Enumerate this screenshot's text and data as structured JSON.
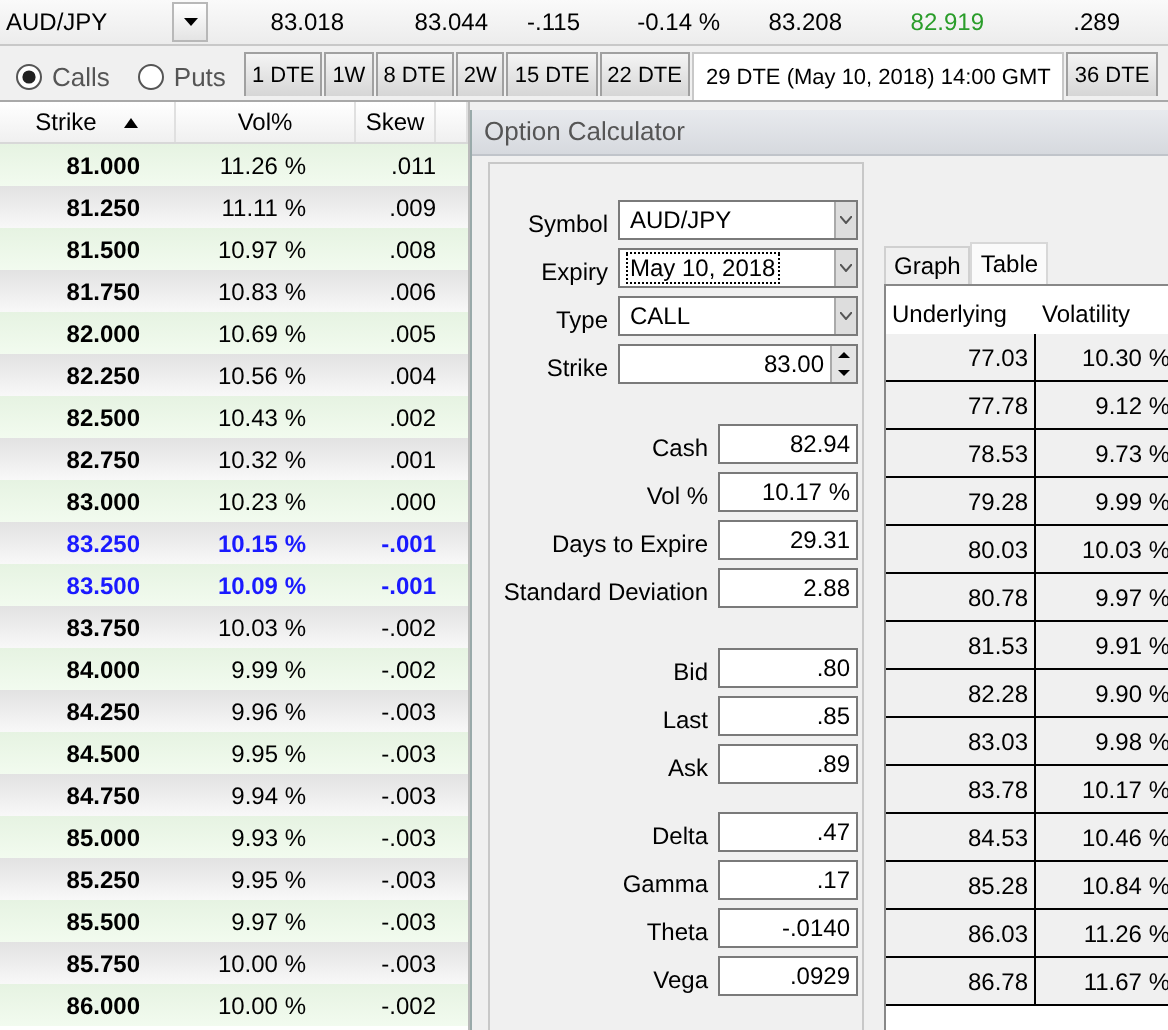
{
  "ticker": {
    "symbol": "AUD/JPY",
    "quotes": [
      {
        "text": "83.018",
        "kind": "plain"
      },
      {
        "text": "83.044",
        "kind": "plain"
      },
      {
        "text": "-.115",
        "kind": "plain"
      },
      {
        "text": "-0.14 %",
        "kind": "plain"
      },
      {
        "text": "83.208",
        "kind": "plain"
      },
      {
        "text": "82.919",
        "kind": "up"
      },
      {
        "text": ".289",
        "kind": "plain"
      }
    ]
  },
  "option_types": [
    {
      "label": "Calls",
      "selected": true
    },
    {
      "label": "Puts",
      "selected": false
    }
  ],
  "expiry_tabs": [
    {
      "label": "1 DTE",
      "selected": false
    },
    {
      "label": "1W",
      "selected": false
    },
    {
      "label": "8 DTE",
      "selected": false
    },
    {
      "label": "2W",
      "selected": false
    },
    {
      "label": "15 DTE",
      "selected": false
    },
    {
      "label": "22 DTE",
      "selected": false
    },
    {
      "label": "29 DTE (May 10, 2018) 14:00 GMT",
      "selected": true
    },
    {
      "label": "36 DTE",
      "selected": false
    }
  ],
  "chain": {
    "columns": [
      {
        "label": "Strike",
        "sorted": true
      },
      {
        "label": "Vol%",
        "sorted": false
      },
      {
        "label": "Skew",
        "sorted": false
      }
    ],
    "rows": [
      {
        "strike": "81.000",
        "vol": "11.26 %",
        "skew": ".011",
        "highlighted": false
      },
      {
        "strike": "81.250",
        "vol": "11.11 %",
        "skew": ".009",
        "highlighted": false
      },
      {
        "strike": "81.500",
        "vol": "10.97 %",
        "skew": ".008",
        "highlighted": false
      },
      {
        "strike": "81.750",
        "vol": "10.83 %",
        "skew": ".006",
        "highlighted": false
      },
      {
        "strike": "82.000",
        "vol": "10.69 %",
        "skew": ".005",
        "highlighted": false
      },
      {
        "strike": "82.250",
        "vol": "10.56 %",
        "skew": ".004",
        "highlighted": false
      },
      {
        "strike": "82.500",
        "vol": "10.43 %",
        "skew": ".002",
        "highlighted": false
      },
      {
        "strike": "82.750",
        "vol": "10.32 %",
        "skew": ".001",
        "highlighted": false
      },
      {
        "strike": "83.000",
        "vol": "10.23 %",
        "skew": ".000",
        "highlighted": false
      },
      {
        "strike": "83.250",
        "vol": "10.15 %",
        "skew": "-.001",
        "highlighted": true
      },
      {
        "strike": "83.500",
        "vol": "10.09 %",
        "skew": "-.001",
        "highlighted": true
      },
      {
        "strike": "83.750",
        "vol": "10.03 %",
        "skew": "-.002",
        "highlighted": false
      },
      {
        "strike": "84.000",
        "vol": "9.99 %",
        "skew": "-.002",
        "highlighted": false
      },
      {
        "strike": "84.250",
        "vol": "9.96 %",
        "skew": "-.003",
        "highlighted": false
      },
      {
        "strike": "84.500",
        "vol": "9.95 %",
        "skew": "-.003",
        "highlighted": false
      },
      {
        "strike": "84.750",
        "vol": "9.94 %",
        "skew": "-.003",
        "highlighted": false
      },
      {
        "strike": "85.000",
        "vol": "9.93 %",
        "skew": "-.003",
        "highlighted": false
      },
      {
        "strike": "85.250",
        "vol": "9.95 %",
        "skew": "-.003",
        "highlighted": false
      },
      {
        "strike": "85.500",
        "vol": "9.97 %",
        "skew": "-.003",
        "highlighted": false
      },
      {
        "strike": "85.750",
        "vol": "10.00 %",
        "skew": "-.003",
        "highlighted": false
      },
      {
        "strike": "86.000",
        "vol": "10.00 %",
        "skew": "-.002",
        "highlighted": false
      }
    ]
  },
  "calculator": {
    "title": "Option Calculator",
    "groups": [
      [
        {
          "kind": "select",
          "label": "Symbol",
          "value": "AUD/JPY",
          "focused": false
        },
        {
          "kind": "select",
          "label": "Expiry",
          "value": "May 10, 2018",
          "focused": true
        },
        {
          "kind": "select",
          "label": "Type",
          "value": "CALL",
          "focused": false
        },
        {
          "kind": "spinner",
          "label": "Strike",
          "value": "83.00"
        }
      ],
      [
        {
          "kind": "number",
          "label": "Cash",
          "value": "82.94"
        },
        {
          "kind": "number",
          "label": "Vol %",
          "value": "10.17 %"
        },
        {
          "kind": "number",
          "label": "Days to Expire",
          "value": "29.31"
        },
        {
          "kind": "number",
          "label": "Standard Deviation",
          "value": "2.88"
        }
      ],
      [
        {
          "kind": "number",
          "label": "Bid",
          "value": ".80"
        },
        {
          "kind": "number",
          "label": "Last",
          "value": ".85"
        },
        {
          "kind": "number",
          "label": "Ask",
          "value": ".89"
        }
      ],
      [
        {
          "kind": "number",
          "label": "Delta",
          "value": ".47"
        },
        {
          "kind": "number",
          "label": "Gamma",
          "value": ".17"
        },
        {
          "kind": "number",
          "label": "Theta",
          "value": "-.0140"
        },
        {
          "kind": "number",
          "label": "Vega",
          "value": ".0929"
        }
      ]
    ],
    "tabs": [
      {
        "label": "Graph",
        "selected": false
      },
      {
        "label": "Table",
        "selected": true
      }
    ],
    "table": {
      "columns": [
        "Underlying",
        "Volatility"
      ],
      "rows": [
        [
          "77.03",
          "10.30 %"
        ],
        [
          "77.78",
          "9.12 %"
        ],
        [
          "78.53",
          "9.73 %"
        ],
        [
          "79.28",
          "9.99 %"
        ],
        [
          "80.03",
          "10.03 %"
        ],
        [
          "80.78",
          "9.97 %"
        ],
        [
          "81.53",
          "9.91 %"
        ],
        [
          "82.28",
          "9.90 %"
        ],
        [
          "83.03",
          "9.98 %"
        ],
        [
          "83.78",
          "10.17 %"
        ],
        [
          "84.53",
          "10.46 %"
        ],
        [
          "85.28",
          "10.84 %"
        ],
        [
          "86.03",
          "11.26 %"
        ],
        [
          "86.78",
          "11.67 %"
        ]
      ]
    }
  }
}
